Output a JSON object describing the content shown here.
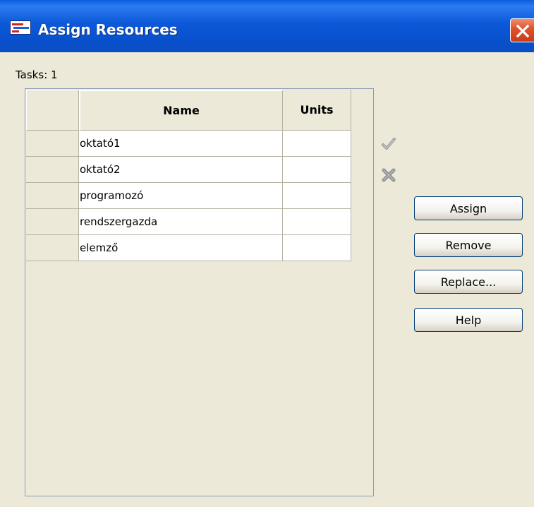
{
  "window": {
    "title": "Assign Resources"
  },
  "tasks_label": "Tasks: 1",
  "grid": {
    "columns": [
      "Name",
      "Units"
    ],
    "rows": [
      {
        "name": "oktató1",
        "units": ""
      },
      {
        "name": "oktató2",
        "units": ""
      },
      {
        "name": "programozó",
        "units": ""
      },
      {
        "name": "rendszergazda",
        "units": ""
      },
      {
        "name": "elemző",
        "units": ""
      }
    ]
  },
  "side_icons": [
    "checkmark-icon",
    "x-icon"
  ],
  "buttons": {
    "assign": "Assign",
    "remove": "Remove",
    "replace": "Replace...",
    "help": "Help"
  },
  "colors": {
    "titlebar": "#0a5fe0",
    "dialog_bg": "#ece9d8",
    "close": "#e05530"
  }
}
